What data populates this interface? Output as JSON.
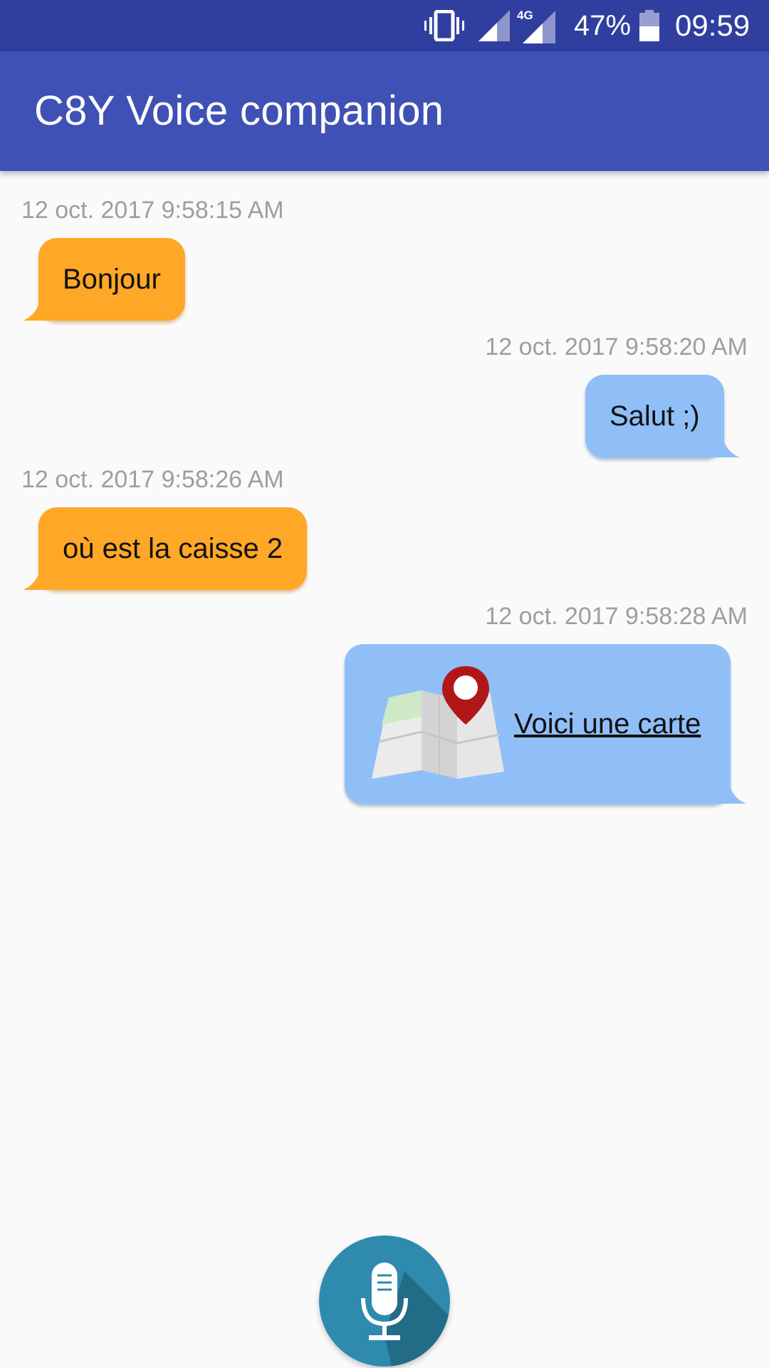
{
  "status_bar": {
    "network": "4G",
    "battery_percent": "47%",
    "time": "09:59",
    "icons": [
      "vibrate-icon",
      "signal-icon",
      "signal-4g-icon",
      "battery-icon"
    ]
  },
  "app_bar": {
    "title": "C8Y Voice companion"
  },
  "messages": [
    {
      "side": "left",
      "timestamp": "12 oct. 2017 9:58:15 AM",
      "text": "Bonjour"
    },
    {
      "side": "right",
      "timestamp": "12 oct. 2017 9:58:20 AM",
      "text": "Salut ;)"
    },
    {
      "side": "left",
      "timestamp": "12 oct. 2017 9:58:26 AM",
      "text": "où est la caisse 2"
    },
    {
      "side": "right",
      "timestamp": "12 oct. 2017 9:58:28 AM",
      "text": "Voici une carte",
      "icon": "map-pin-icon"
    }
  ],
  "mic_button": {
    "icon": "microphone-icon"
  },
  "colors": {
    "status_bar": "#303f9f",
    "app_bar": "#3f51b5",
    "incoming_bubble": "#ffa726",
    "outgoing_bubble": "#90bff8",
    "timestamp": "#9e9e9e",
    "mic_button": "#2e8bad"
  }
}
